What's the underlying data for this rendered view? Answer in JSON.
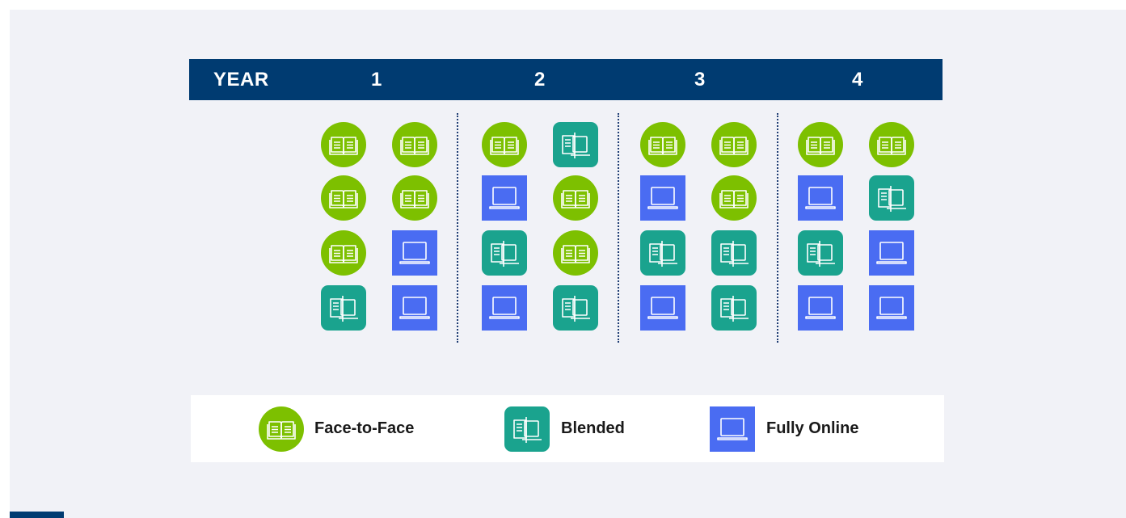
{
  "header": {
    "year_label": "YEAR",
    "years": [
      "1",
      "2",
      "3",
      "4"
    ]
  },
  "legend": {
    "items": [
      {
        "type": "f2f",
        "label": "Face-to-Face"
      },
      {
        "type": "blended",
        "label": "Blended"
      },
      {
        "type": "online",
        "label": "Fully Online"
      }
    ]
  },
  "grid": {
    "year1": [
      [
        "f2f",
        "f2f"
      ],
      [
        "f2f",
        "f2f"
      ],
      [
        "f2f",
        "online"
      ],
      [
        "blended",
        "online"
      ]
    ],
    "year2": [
      [
        "f2f",
        "blended"
      ],
      [
        "online",
        "f2f"
      ],
      [
        "blended",
        "f2f"
      ],
      [
        "online",
        "blended"
      ]
    ],
    "year3": [
      [
        "f2f",
        "f2f"
      ],
      [
        "online",
        "f2f"
      ],
      [
        "blended",
        "blended"
      ],
      [
        "online",
        "blended"
      ]
    ],
    "year4": [
      [
        "f2f",
        "f2f"
      ],
      [
        "online",
        "blended"
      ],
      [
        "blended",
        "online"
      ],
      [
        "online",
        "online"
      ]
    ]
  },
  "colors": {
    "f2f": "#7dc000",
    "blended": "#1aa38e",
    "online": "#4a6cf2",
    "header": "#003b71",
    "background": "#f1f2f7"
  },
  "icons": {
    "f2f": "open-book-icon",
    "blended": "book-laptop-icon",
    "online": "laptop-icon"
  }
}
